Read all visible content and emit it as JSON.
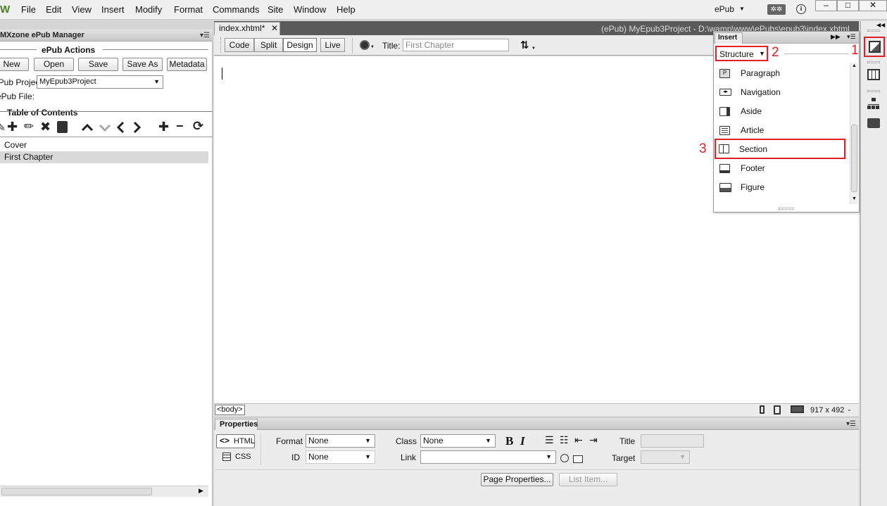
{
  "app": {
    "logo": "W",
    "menu": [
      "File",
      "Edit",
      "View",
      "Insert",
      "Modify",
      "Format",
      "Commands",
      "Site",
      "Window",
      "Help"
    ],
    "workspace": "ePub",
    "info_glyph": "i",
    "window_controls": [
      "minimize-icon",
      "restore-icon",
      "close-icon"
    ]
  },
  "epub_manager": {
    "panel_title": "MXzone ePub Manager",
    "actions_title": "ePub Actions",
    "buttons": [
      "New",
      "Open",
      "Save",
      "Save As",
      "Metadata"
    ],
    "project_label": "ePub Project:",
    "project_value": "MyEpub3Project",
    "file_label": "ePub File:",
    "toc_title": "Table of Contents",
    "toc_tools": [
      "pen-icon",
      "add-icon",
      "pencil-icon",
      "delete-icon",
      "trash-icon",
      "move-up-icon",
      "move-down-icon",
      "outdent-icon",
      "indent-icon",
      "add-child-icon",
      "remove-icon",
      "refresh-icon"
    ],
    "toc_items": [
      {
        "label": "Cover",
        "selected": false
      },
      {
        "label": "First Chapter",
        "selected": true
      }
    ]
  },
  "document": {
    "tab_label": "index.xhtml*",
    "path": "(ePub) MyEpub3Project - D:\\wamp\\www\\ePubs\\epub3\\index.xhtml",
    "views": [
      "Code",
      "Split",
      "Design",
      "Live"
    ],
    "active_view": "Design",
    "title_label": "Title:",
    "title_value": "First Chapter",
    "tag_selector": "<body>",
    "window_size": "917 x 492"
  },
  "insert_panel": {
    "tab": "Insert",
    "category": "Structure",
    "items": [
      {
        "label": "Paragraph",
        "icon": "paragraph-icon"
      },
      {
        "label": "Navigation",
        "icon": "navigation-icon"
      },
      {
        "label": "Aside",
        "icon": "aside-icon"
      },
      {
        "label": "Article",
        "icon": "article-icon"
      },
      {
        "label": "Section",
        "icon": "section-icon"
      },
      {
        "label": "Footer",
        "icon": "footer-icon"
      },
      {
        "label": "Figure",
        "icon": "figure-icon"
      }
    ]
  },
  "annotations": {
    "step1": "1",
    "step2": "2",
    "step3": "3",
    "color": "#e01f26"
  },
  "properties": {
    "tab": "Properties",
    "html_btn": "HTML",
    "css_btn": "CSS",
    "format_label": "Format",
    "format_value": "None",
    "id_label": "ID",
    "id_value": "None",
    "class_label": "Class",
    "class_value": "None",
    "link_label": "Link",
    "link_value": "",
    "bold": "B",
    "italic": "I",
    "title_label": "Title",
    "target_label": "Target",
    "page_props_btn": "Page Properties...",
    "list_item_btn": "List Item..."
  }
}
